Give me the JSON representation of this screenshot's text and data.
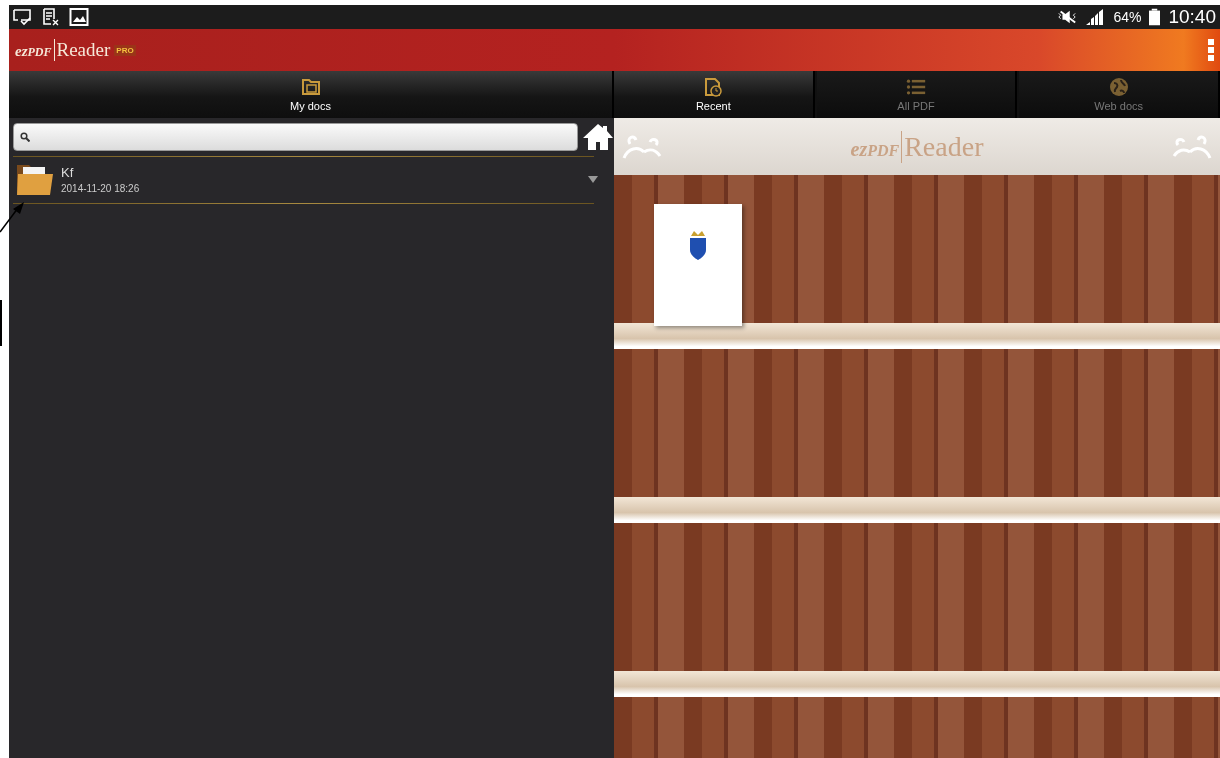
{
  "status_bar": {
    "battery": "64%",
    "time": "10:40"
  },
  "app_bar": {
    "logo_mark": "ez",
    "logo_pdf": "PDF",
    "logo_name": "Reader",
    "badge": "PRO"
  },
  "left_tabs": [
    {
      "label": "My docs",
      "selected": true,
      "kind": "folder"
    }
  ],
  "right_tabs": [
    {
      "label": "Recent",
      "selected": true,
      "kind": "recent"
    },
    {
      "label": "All PDF",
      "selected": false,
      "kind": "list"
    },
    {
      "label": "Web docs",
      "selected": false,
      "kind": "globe"
    }
  ],
  "files": [
    {
      "name": "Kf",
      "date": "2014-11-20 18:26"
    }
  ],
  "shelf_header": {
    "logo_mark": "ez",
    "logo_pdf": "PDF",
    "logo_name": "Reader"
  },
  "bookshelf": {
    "books": [
      {
        "kind": "document"
      }
    ]
  }
}
